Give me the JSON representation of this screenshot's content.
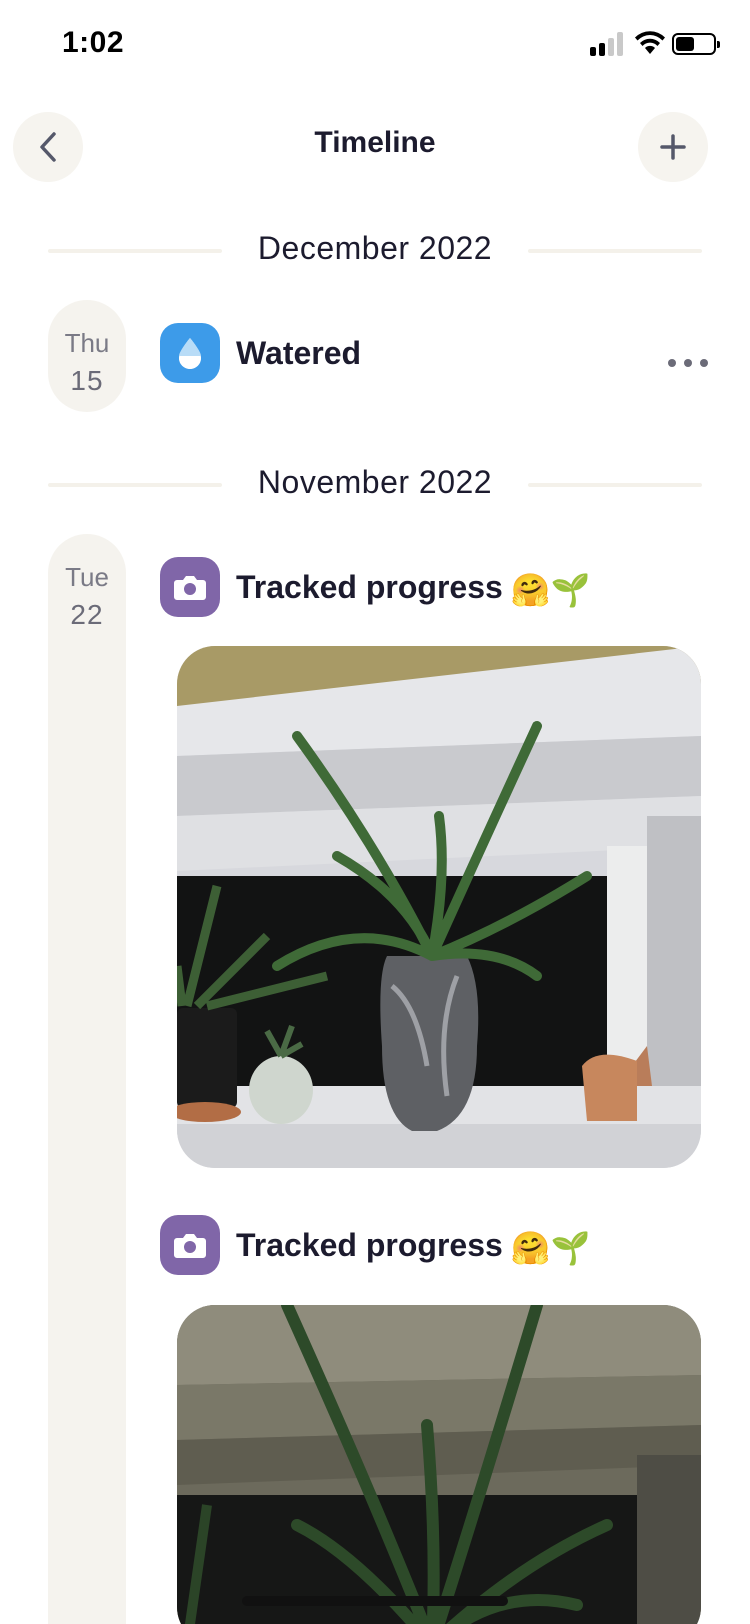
{
  "status_bar": {
    "time": "1:02"
  },
  "nav": {
    "title": "Timeline"
  },
  "sections": [
    {
      "month": "December 2022",
      "date": {
        "dow": "Thu",
        "day": "15"
      },
      "events": [
        {
          "title": "Watered",
          "icon": "water-drop-icon"
        }
      ]
    },
    {
      "month": "November 2022",
      "date": {
        "dow": "Tue",
        "day": "22"
      },
      "events": [
        {
          "title": "Tracked progress",
          "emoji": "🤗🌱",
          "icon": "camera-icon"
        },
        {
          "title": "Tracked progress",
          "emoji": "🤗🌱",
          "icon": "camera-icon"
        }
      ]
    }
  ],
  "colors": {
    "water": "#3d9be9",
    "camera": "#8066a8",
    "pill": "#f5f3ee",
    "text": "#1c1b2e"
  }
}
